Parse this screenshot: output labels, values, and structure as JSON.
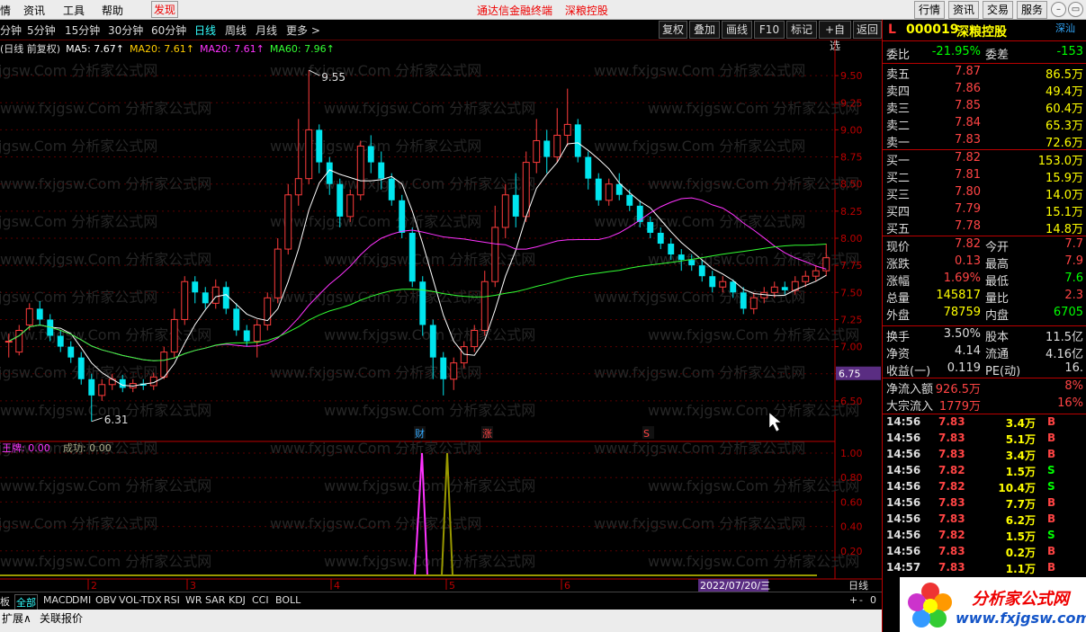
{
  "menu": {
    "items": [
      "情",
      "资讯",
      "工具",
      "帮助",
      "发现"
    ],
    "center": [
      "通达信金融终端",
      "深粮控股"
    ],
    "right_buttons": [
      "行情",
      "资讯",
      "交易",
      "服务"
    ]
  },
  "toolbar": {
    "periods": [
      "分钟",
      "5分钟",
      "15分钟",
      "30分钟",
      "60分钟",
      "日线",
      "周线",
      "月线",
      "更多 >"
    ],
    "active_period": "日线",
    "buttons": [
      "复权",
      "叠加",
      "画线",
      "F10",
      "标记",
      "+自选",
      "返回"
    ]
  },
  "legend": {
    "prefix": "(日线 前复权)",
    "ma5": "MA5: 7.67↑",
    "ma20": "MA20: 7.61↑",
    "ma20b": "MA20: 7.61↑",
    "ma60": "MA60: 7.96↑",
    "colors": {
      "ma5": "#ffffff",
      "ma20": "#ffcc00",
      "ma20b": "#ff33ff",
      "ma60": "#33ff33"
    }
  },
  "chart_data": {
    "type": "candlestick",
    "y_ticks": [
      "9.50",
      "9.25",
      "9.00",
      "8.75",
      "8.50",
      "8.25",
      "8.00",
      "7.75",
      "7.50",
      "7.25",
      "7.00",
      "6.75",
      "6.50"
    ],
    "current_price_tag": "6.75",
    "high_label": "9.55",
    "low_label": "6.31",
    "event_markers": [
      "财",
      "涨",
      "S"
    ],
    "month_labels": [
      "2",
      "3",
      "4",
      "5",
      "6"
    ],
    "date_tag": "2022/07/20/三",
    "ylim": [
      6.3,
      9.7
    ],
    "candles": [
      [
        7.05,
        7.05,
        6.9,
        7.12
      ],
      [
        6.95,
        7.15,
        6.92,
        7.2
      ],
      [
        7.2,
        7.35,
        7.15,
        7.4
      ],
      [
        7.35,
        7.25,
        7.2,
        7.42
      ],
      [
        7.25,
        7.1,
        7.05,
        7.3
      ],
      [
        7.1,
        7.0,
        6.95,
        7.15
      ],
      [
        7.0,
        6.9,
        6.85,
        7.05
      ],
      [
        6.9,
        6.7,
        6.65,
        6.95
      ],
      [
        6.7,
        6.55,
        6.31,
        6.75
      ],
      [
        6.55,
        6.65,
        6.5,
        6.7
      ],
      [
        6.65,
        6.7,
        6.6,
        6.75
      ],
      [
        6.7,
        6.62,
        6.58,
        6.74
      ],
      [
        6.62,
        6.66,
        6.58,
        6.7
      ],
      [
        6.66,
        6.64,
        6.6,
        6.7
      ],
      [
        6.64,
        6.72,
        6.6,
        6.76
      ],
      [
        6.72,
        6.95,
        6.7,
        7.0
      ],
      [
        6.95,
        7.25,
        6.9,
        7.35
      ],
      [
        7.25,
        7.6,
        7.2,
        7.65
      ],
      [
        7.6,
        7.5,
        7.4,
        7.65
      ],
      [
        7.5,
        7.4,
        7.35,
        7.55
      ],
      [
        7.4,
        7.55,
        7.35,
        7.62
      ],
      [
        7.55,
        7.35,
        7.3,
        7.6
      ],
      [
        7.35,
        7.15,
        7.1,
        7.4
      ],
      [
        7.15,
        7.05,
        7.0,
        7.2
      ],
      [
        7.05,
        7.2,
        6.9,
        7.25
      ],
      [
        7.2,
        7.45,
        7.15,
        7.5
      ],
      [
        7.45,
        7.9,
        7.4,
        8.0
      ],
      [
        7.9,
        8.4,
        7.85,
        8.5
      ],
      [
        8.4,
        8.55,
        8.3,
        9.1
      ],
      [
        8.55,
        9.0,
        8.5,
        9.55
      ],
      [
        9.0,
        8.7,
        8.6,
        9.05
      ],
      [
        8.7,
        8.5,
        8.4,
        8.75
      ],
      [
        8.5,
        8.2,
        8.1,
        8.55
      ],
      [
        8.2,
        8.4,
        8.15,
        8.45
      ],
      [
        8.4,
        8.85,
        8.35,
        8.9
      ],
      [
        8.85,
        8.7,
        8.6,
        8.95
      ],
      [
        8.7,
        8.55,
        8.45,
        8.8
      ],
      [
        8.55,
        8.35,
        8.3,
        8.6
      ],
      [
        8.35,
        8.05,
        8.0,
        8.4
      ],
      [
        8.05,
        7.6,
        7.55,
        8.1
      ],
      [
        7.6,
        7.2,
        7.1,
        7.65
      ],
      [
        7.2,
        6.9,
        6.7,
        7.25
      ],
      [
        6.9,
        6.7,
        6.55,
        6.95
      ],
      [
        6.7,
        6.85,
        6.6,
        6.9
      ],
      [
        6.85,
        7.0,
        6.8,
        7.05
      ],
      [
        7.0,
        7.15,
        6.95,
        7.2
      ],
      [
        7.15,
        7.6,
        7.1,
        7.7
      ],
      [
        7.6,
        8.1,
        7.55,
        8.3
      ],
      [
        8.1,
        8.4,
        8.0,
        8.5
      ],
      [
        8.4,
        8.2,
        8.1,
        8.6
      ],
      [
        8.2,
        8.7,
        8.15,
        8.8
      ],
      [
        8.7,
        8.9,
        8.6,
        9.1
      ],
      [
        8.9,
        8.75,
        8.6,
        9.0
      ],
      [
        8.75,
        8.95,
        8.7,
        9.2
      ],
      [
        8.95,
        9.05,
        8.85,
        9.38
      ],
      [
        9.05,
        8.75,
        8.7,
        9.1
      ],
      [
        8.75,
        8.55,
        8.45,
        8.8
      ],
      [
        8.55,
        8.35,
        8.3,
        8.6
      ],
      [
        8.35,
        8.5,
        8.3,
        8.55
      ],
      [
        8.5,
        8.4,
        8.35,
        8.6
      ],
      [
        8.4,
        8.3,
        8.25,
        8.45
      ],
      [
        8.3,
        8.15,
        8.1,
        8.35
      ],
      [
        8.15,
        8.05,
        8.0,
        8.2
      ],
      [
        8.05,
        7.95,
        7.9,
        8.1
      ],
      [
        7.95,
        7.85,
        7.8,
        8.0
      ],
      [
        7.85,
        7.8,
        7.7,
        7.9
      ],
      [
        7.8,
        7.75,
        7.7,
        7.85
      ],
      [
        7.75,
        7.65,
        7.6,
        7.8
      ],
      [
        7.65,
        7.55,
        7.5,
        7.7
      ],
      [
        7.55,
        7.6,
        7.5,
        7.65
      ],
      [
        7.6,
        7.5,
        7.45,
        7.62
      ],
      [
        7.5,
        7.35,
        7.3,
        7.55
      ],
      [
        7.35,
        7.45,
        7.3,
        7.5
      ],
      [
        7.45,
        7.5,
        7.4,
        7.55
      ],
      [
        7.5,
        7.55,
        7.45,
        7.6
      ],
      [
        7.55,
        7.52,
        7.48,
        7.6
      ],
      [
        7.52,
        7.6,
        7.48,
        7.65
      ],
      [
        7.6,
        7.65,
        7.55,
        7.7
      ],
      [
        7.65,
        7.7,
        7.6,
        7.75
      ],
      [
        7.7,
        7.82,
        7.65,
        7.95
      ]
    ]
  },
  "indicator": {
    "label1": "王牌: 0.00",
    "label2": "成功: 0.00",
    "y_ticks": [
      "1.00",
      "0.80",
      "0.60",
      "0.40",
      "0.20"
    ],
    "left_tag": "日线",
    "spike1_color": "#ff33ff",
    "spike2_color": "#999900"
  },
  "bottom_tabs": [
    "板",
    "全部",
    "MACD",
    "DMI",
    "OBV",
    "VOL-TDX",
    "RSI",
    "WR",
    "SAR",
    "KDJ",
    "CCI",
    "BOLL"
  ],
  "status": [
    "扩展∧",
    "关联报价"
  ],
  "panel": {
    "market": "深汕",
    "code": "000019",
    "name": "深粮控股",
    "weibi_label": "委比",
    "weibi": "-21.95%",
    "weicha_label": "委差",
    "weicha": "-153",
    "sell": [
      {
        "label": "卖五",
        "price": "7.87",
        "vol": "86.5万"
      },
      {
        "label": "卖四",
        "price": "7.86",
        "vol": "49.4万"
      },
      {
        "label": "卖三",
        "price": "7.85",
        "vol": "60.4万"
      },
      {
        "label": "卖二",
        "price": "7.84",
        "vol": "65.3万"
      },
      {
        "label": "卖一",
        "price": "7.83",
        "vol": "72.6万"
      }
    ],
    "buy": [
      {
        "label": "买一",
        "price": "7.82",
        "vol": "153.0万"
      },
      {
        "label": "买二",
        "price": "7.81",
        "vol": "15.9万"
      },
      {
        "label": "买三",
        "price": "7.80",
        "vol": "14.0万"
      },
      {
        "label": "买四",
        "price": "7.79",
        "vol": "15.1万"
      },
      {
        "label": "买五",
        "price": "7.78",
        "vol": "14.8万"
      }
    ],
    "stats": [
      {
        "l1": "现价",
        "v1": "7.82",
        "l2": "今开",
        "v2": "7.7"
      },
      {
        "l1": "涨跌",
        "v1": "0.13",
        "l2": "最高",
        "v2": "7.9"
      },
      {
        "l1": "涨幅",
        "v1": "1.69%",
        "l2": "最低",
        "v2": "7.6"
      },
      {
        "l1": "总量",
        "v1": "145817",
        "l2": "量比",
        "v2": "2.3"
      },
      {
        "l1": "外盘",
        "v1": "78759",
        "l2": "内盘",
        "v2": "6705"
      }
    ],
    "fund": [
      {
        "l1": "换手",
        "v1": "3.50%",
        "l2": "股本",
        "v2": "11.5亿"
      },
      {
        "l1": "净资",
        "v1": "4.14",
        "l2": "流通",
        "v2": "4.16亿"
      },
      {
        "l1": "收益(一)",
        "v1": "0.119",
        "l2": "PE(动)",
        "v2": "16."
      }
    ],
    "flow": [
      {
        "l1": "净流入额",
        "v1": "926.5万",
        "v2": "8%"
      },
      {
        "l1": "大宗流入",
        "v1": "1779万",
        "v2": "16%"
      }
    ],
    "ticks": [
      {
        "t": "14:56",
        "p": "7.83",
        "q": "3.4万",
        "d": "B"
      },
      {
        "t": "14:56",
        "p": "7.83",
        "q": "5.1万",
        "d": "B"
      },
      {
        "t": "14:56",
        "p": "7.83",
        "q": "3.4万",
        "d": "B"
      },
      {
        "t": "14:56",
        "p": "7.82",
        "q": "1.5万",
        "d": "S"
      },
      {
        "t": "14:56",
        "p": "7.82",
        "q": "10.4万",
        "d": "S"
      },
      {
        "t": "14:56",
        "p": "7.83",
        "q": "7.7万",
        "d": "B"
      },
      {
        "t": "14:56",
        "p": "7.83",
        "q": "6.2万",
        "d": "B"
      },
      {
        "t": "14:56",
        "p": "7.82",
        "q": "1.5万",
        "d": "S"
      },
      {
        "t": "14:56",
        "p": "7.83",
        "q": "0.2万",
        "d": "B"
      },
      {
        "t": "14:57",
        "p": "7.83",
        "q": "1.1万",
        "d": "B"
      }
    ]
  },
  "logo": {
    "line1": "分析家公式网",
    "line2": "www.fxjgsw.com"
  },
  "watermark": "www.fxjgsw.Com 分析家公式网"
}
